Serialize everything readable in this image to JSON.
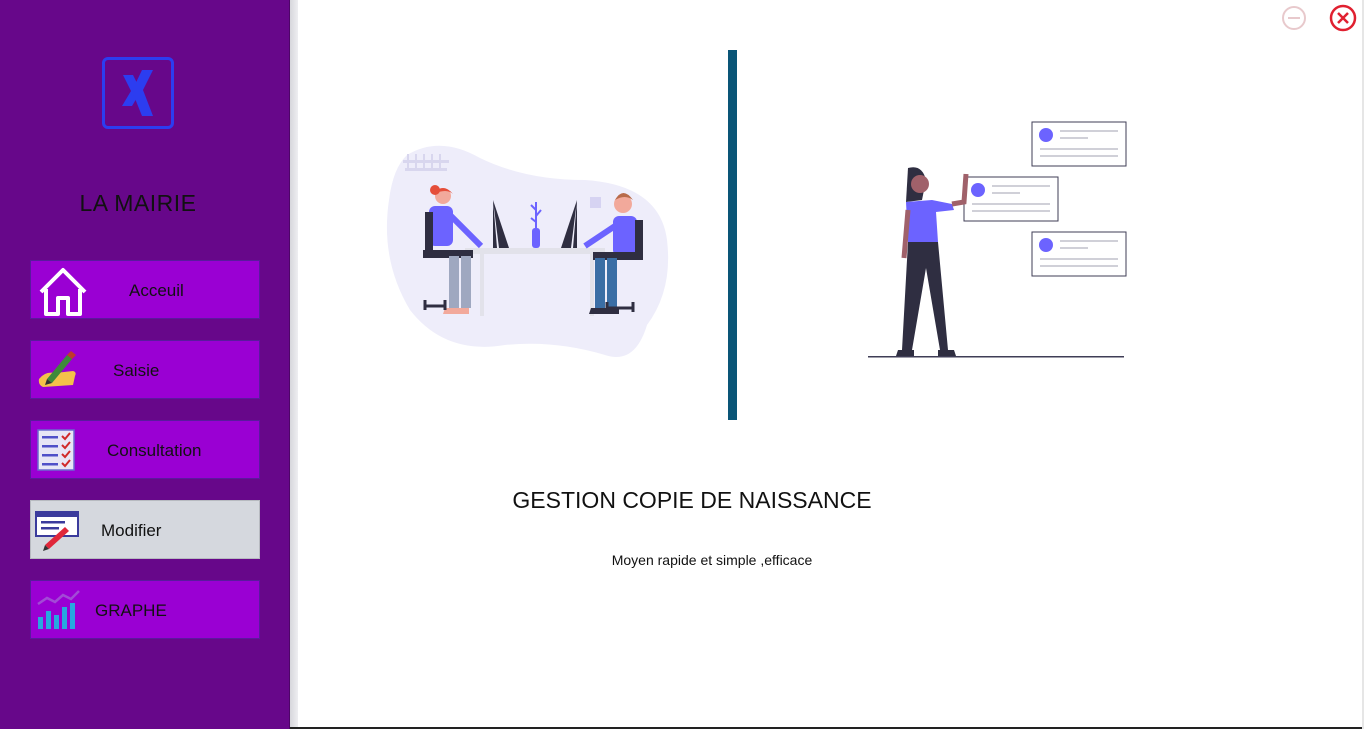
{
  "sidebar": {
    "app_title": "LA MAIRIE",
    "logo_icon": "xing-logo-icon",
    "items": [
      {
        "label": "Acceuil",
        "icon": "home-icon"
      },
      {
        "label": "Saisie",
        "icon": "pen-hand-icon"
      },
      {
        "label": "Consultation",
        "icon": "checklist-icon"
      },
      {
        "label": "Modifier",
        "icon": "edit-form-icon",
        "active": true
      },
      {
        "label": "GRAPHE",
        "icon": "bar-chart-icon"
      }
    ]
  },
  "main": {
    "title": "GESTION COPIE DE NAISSANCE",
    "subtitle": "Moyen rapide et simple ,efficace"
  },
  "window": {
    "minimize_icon": "minus-circle-icon",
    "close_icon": "close-circle-icon"
  },
  "colors": {
    "sidebar_bg": "#67078a",
    "nav_button": "#9a00d3",
    "nav_active": "#d5d8de",
    "accent_line": "#0a5577",
    "close_red": "#e02030",
    "illustration_purple": "#6c63ff"
  }
}
